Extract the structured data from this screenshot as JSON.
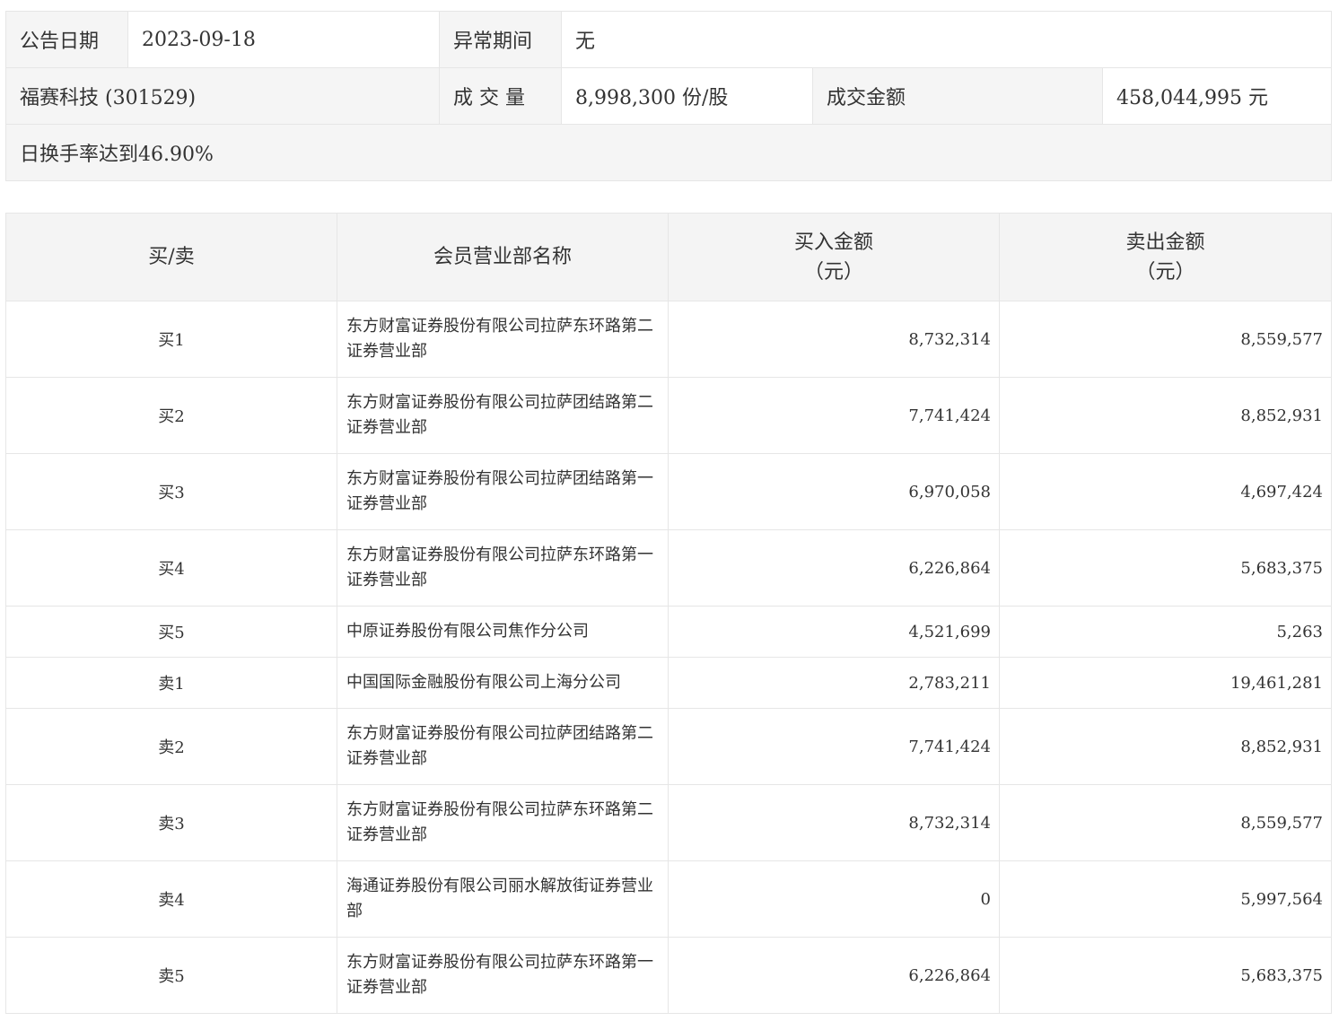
{
  "info": {
    "announce_date_label": "公告日期",
    "announce_date": "2023-09-18",
    "abnormal_period_label": "异常期间",
    "abnormal_period": "无",
    "stock_name": "福赛科技 (301529)",
    "volume_label": "成 交 量",
    "volume": "8,998,300 份/股",
    "turnover_label": "成交金额",
    "turnover": "458,044,995 元",
    "reason": "日换手率达到46.90%"
  },
  "trades": {
    "headers": {
      "side": "买/卖",
      "branch": "会员营业部名称",
      "buy_line1": "买入金额",
      "buy_line2": "（元）",
      "sell_line1": "卖出金额",
      "sell_line2": "（元）"
    },
    "rows": [
      {
        "side": "买1",
        "name": "东方财富证券股份有限公司拉萨东环路第二证券营业部",
        "buy": "8,732,314",
        "sell": "8,559,577"
      },
      {
        "side": "买2",
        "name": "东方财富证券股份有限公司拉萨团结路第二证券营业部",
        "buy": "7,741,424",
        "sell": "8,852,931"
      },
      {
        "side": "买3",
        "name": "东方财富证券股份有限公司拉萨团结路第一证券营业部",
        "buy": "6,970,058",
        "sell": "4,697,424"
      },
      {
        "side": "买4",
        "name": "东方财富证券股份有限公司拉萨东环路第一证券营业部",
        "buy": "6,226,864",
        "sell": "5,683,375"
      },
      {
        "side": "买5",
        "name": "中原证券股份有限公司焦作分公司",
        "buy": "4,521,699",
        "sell": "5,263"
      },
      {
        "side": "卖1",
        "name": "中国国际金融股份有限公司上海分公司",
        "buy": "2,783,211",
        "sell": "19,461,281"
      },
      {
        "side": "卖2",
        "name": "东方财富证券股份有限公司拉萨团结路第二证券营业部",
        "buy": "7,741,424",
        "sell": "8,852,931"
      },
      {
        "side": "卖3",
        "name": "东方财富证券股份有限公司拉萨东环路第二证券营业部",
        "buy": "8,732,314",
        "sell": "8,559,577"
      },
      {
        "side": "卖4",
        "name": "海通证券股份有限公司丽水解放街证券营业部",
        "buy": "0",
        "sell": "5,997,564"
      },
      {
        "side": "卖5",
        "name": "东方财富证券股份有限公司拉萨东环路第一证券营业部",
        "buy": "6,226,864",
        "sell": "5,683,375"
      }
    ]
  }
}
